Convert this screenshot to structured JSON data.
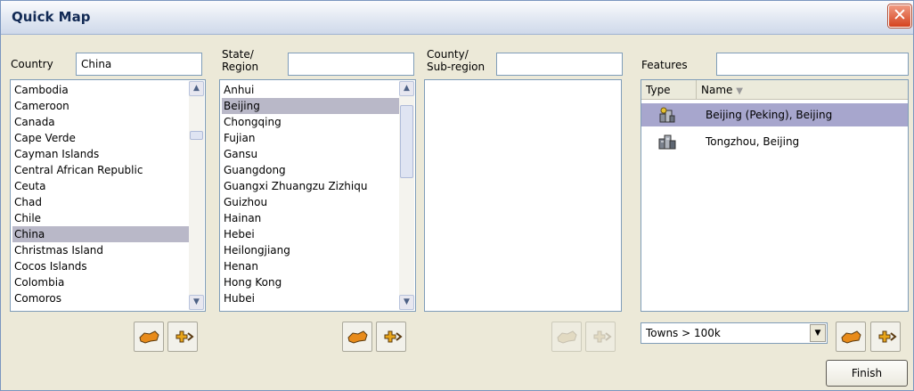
{
  "window": {
    "title": "Quick Map",
    "close": "✕"
  },
  "country": {
    "label": "Country",
    "value": "China",
    "items": [
      "Cambodia",
      "Cameroon",
      "Canada",
      "Cape Verde",
      "Cayman Islands",
      "Central African Republic",
      "Ceuta",
      "Chad",
      "Chile",
      "China",
      "Christmas Island",
      "Cocos Islands",
      "Colombia",
      "Comoros"
    ],
    "selected": "China"
  },
  "state": {
    "label_line1": "State/",
    "label_line2": "Region",
    "value": "",
    "items": [
      "Anhui",
      "Beijing",
      "Chongqing",
      "Fujian",
      "Gansu",
      "Guangdong",
      "Guangxi Zhuangzu Zizhiqu",
      "Guizhou",
      "Hainan",
      "Hebei",
      "Heilongjiang",
      "Henan",
      "Hong Kong",
      "Hubei"
    ],
    "selected": "Beijing"
  },
  "county": {
    "label_line1": "County/",
    "label_line2": "Sub-region",
    "value": "",
    "items": []
  },
  "features": {
    "label": "Features",
    "value": "",
    "col_type": "Type",
    "col_name": "Name",
    "sort_indicator": "▼",
    "rows": [
      {
        "name": "Beijing (Peking), Beijing",
        "icon": "capital-city-icon",
        "selected": true
      },
      {
        "name": "Tongzhou, Beijing",
        "icon": "town-icon",
        "selected": false
      }
    ]
  },
  "filter": {
    "value": "Towns > 100k"
  },
  "finish_label": "Finish",
  "colors": {
    "selection": "#b9b8c8",
    "feature_selection": "#a7a6cd",
    "map_icon": "#e88b1a"
  }
}
